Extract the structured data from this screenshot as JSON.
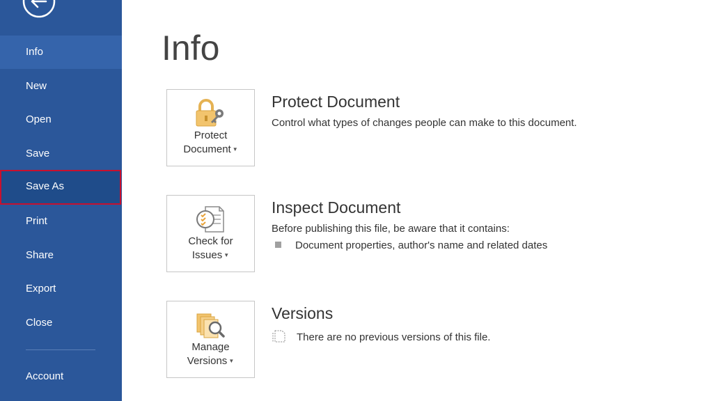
{
  "sidebar": {
    "items": [
      {
        "label": "Info"
      },
      {
        "label": "New"
      },
      {
        "label": "Open"
      },
      {
        "label": "Save"
      },
      {
        "label": "Save As"
      },
      {
        "label": "Print"
      },
      {
        "label": "Share"
      },
      {
        "label": "Export"
      },
      {
        "label": "Close"
      },
      {
        "label": "Account"
      }
    ],
    "active": "Info",
    "highlighted": "Save As"
  },
  "main": {
    "title": "Info",
    "sections": [
      {
        "tile_line1": "Protect",
        "tile_line2": "Document",
        "icon": "lock-key-icon",
        "title": "Protect Document",
        "description": "Control what types of changes people can make to this document."
      },
      {
        "tile_line1": "Check for",
        "tile_line2": "Issues",
        "icon": "inspect-document-icon",
        "title": "Inspect Document",
        "description": "Before publishing this file, be aware that it contains:",
        "bullets": [
          "Document properties, author's name and related dates"
        ]
      },
      {
        "tile_line1": "Manage",
        "tile_line2": "Versions",
        "icon": "manage-versions-icon",
        "title": "Versions",
        "description": "There are no previous versions of this file."
      }
    ]
  },
  "colors": {
    "sidebar": "#2b579a",
    "highlight_border": "#c8102e"
  }
}
